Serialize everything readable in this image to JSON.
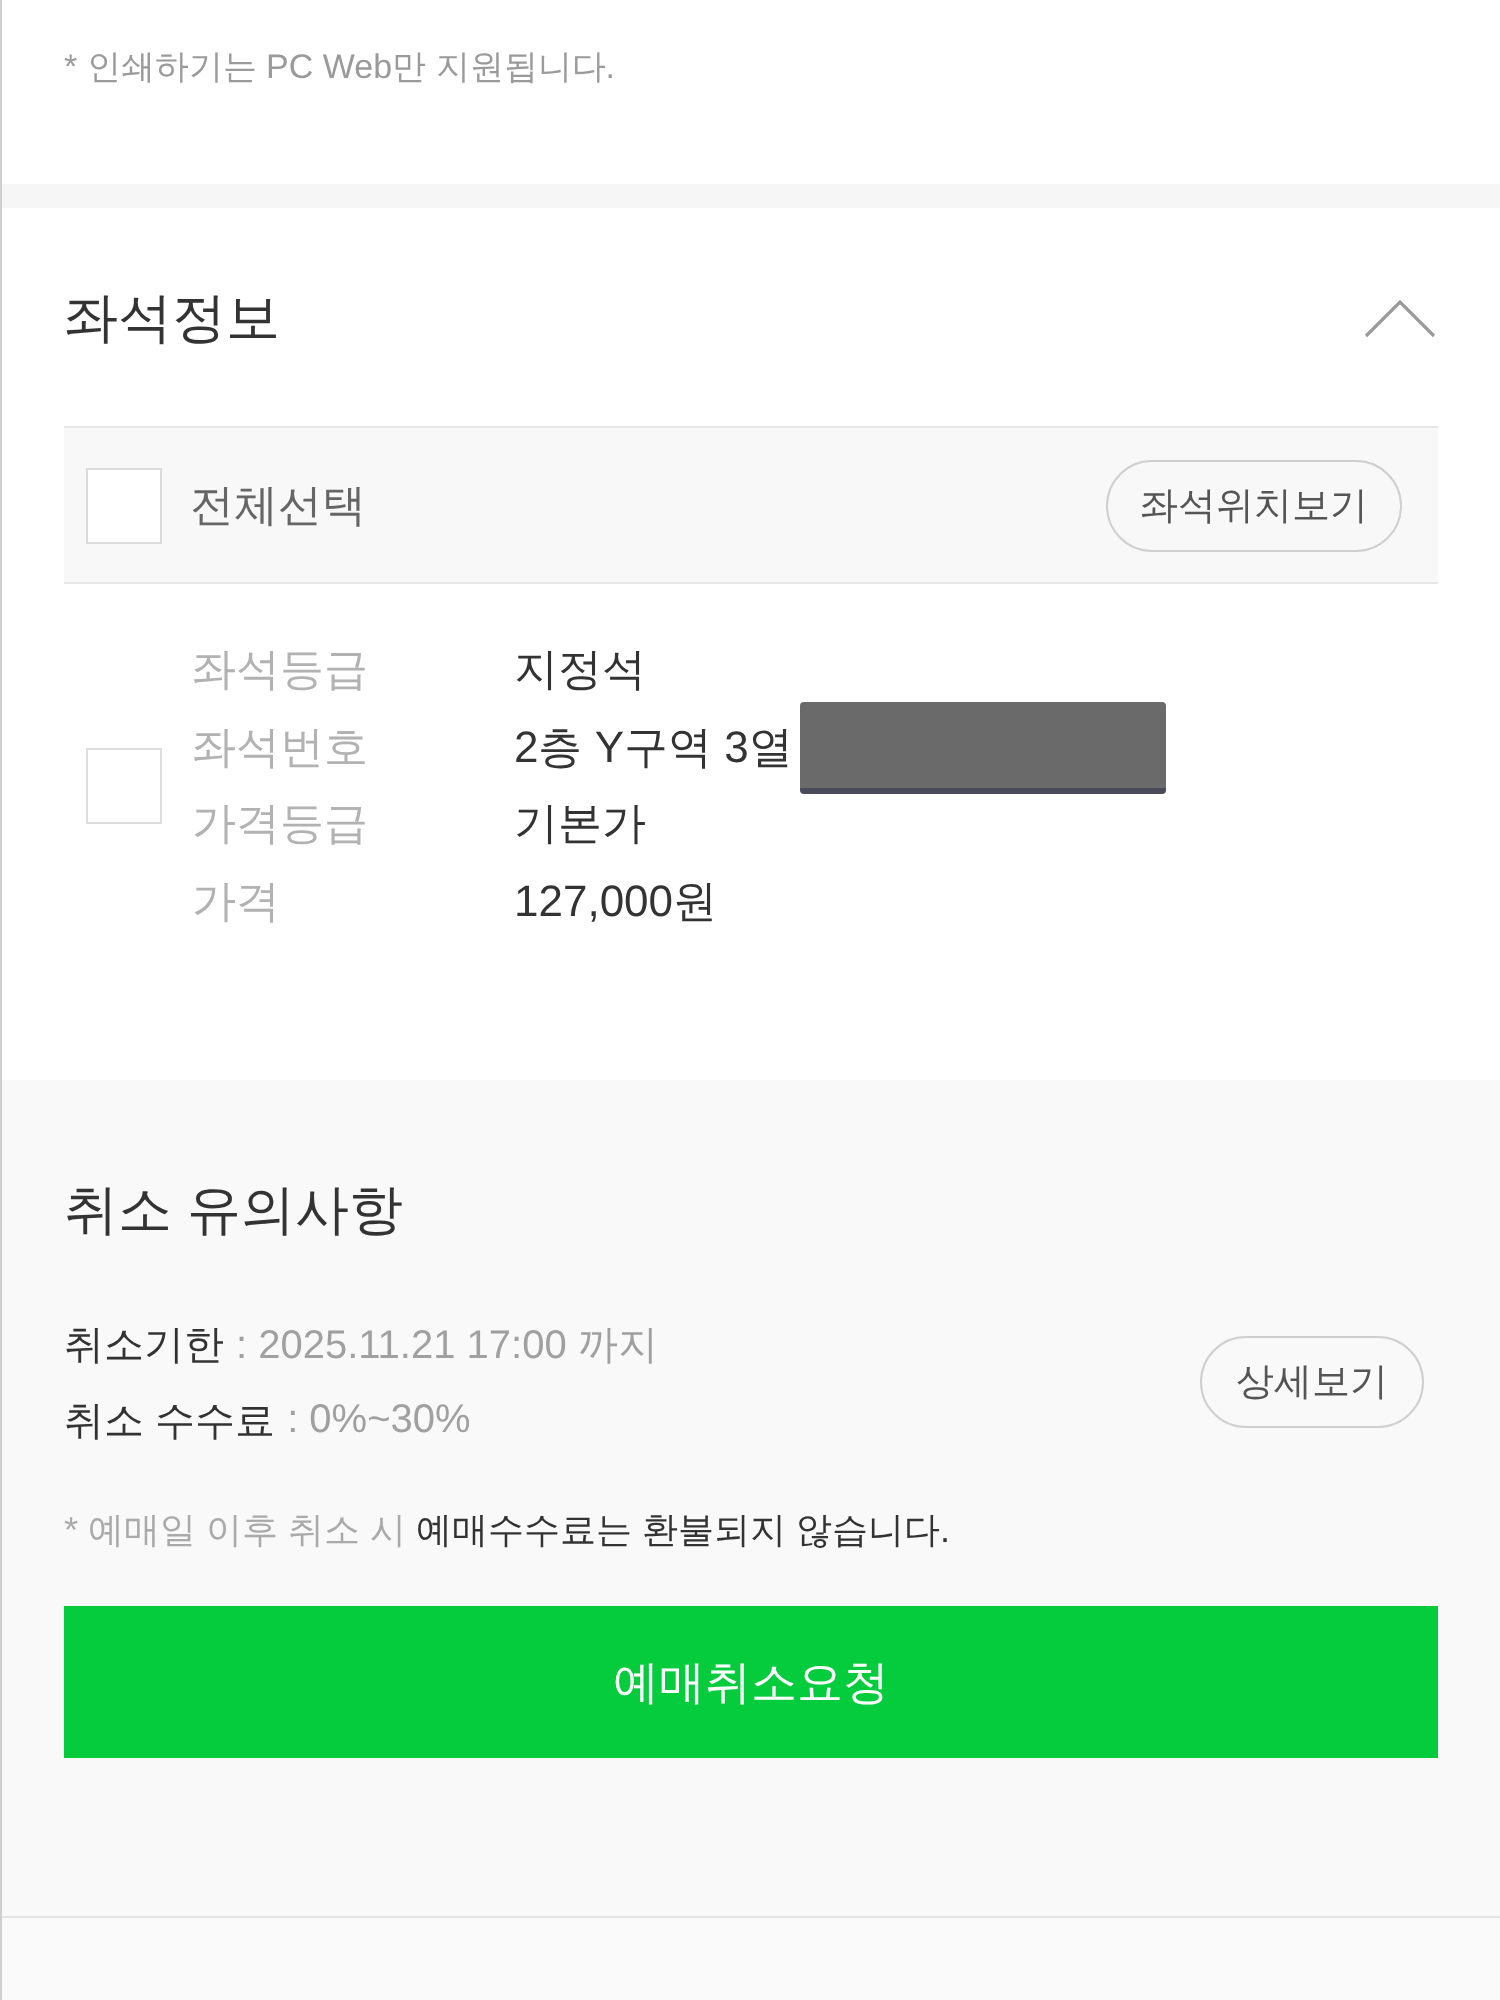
{
  "print_note": "* 인쇄하기는 PC Web만 지원됩니다.",
  "seat_section": {
    "title": "좌석정보",
    "expanded": true,
    "select_all": {
      "label": "전체선택",
      "checked": false
    },
    "seat_map_button": "좌석위치보기",
    "seats": [
      {
        "checked": false,
        "details": [
          {
            "label": "좌석등급",
            "value": "지정석",
            "redacted": false
          },
          {
            "label": "좌석번호",
            "value": "2층 Y구역 3열",
            "redacted": true
          },
          {
            "label": "가격등급",
            "value": "기본가",
            "redacted": false
          },
          {
            "label": "가격",
            "value": "127,000원",
            "redacted": false
          }
        ]
      }
    ]
  },
  "cancel_section": {
    "title": "취소 유의사항",
    "terms": [
      {
        "label": "취소기한",
        "value": ": 2025.11.21 17:00 까지"
      },
      {
        "label": "취소 수수료",
        "value": ": 0%~30%"
      }
    ],
    "detail_button": "상세보기",
    "note": "* 예매일 이후 취소 시 **예매수수료는 환불되지 않습니다.**",
    "cancel_button": "예매취소요청"
  }
}
